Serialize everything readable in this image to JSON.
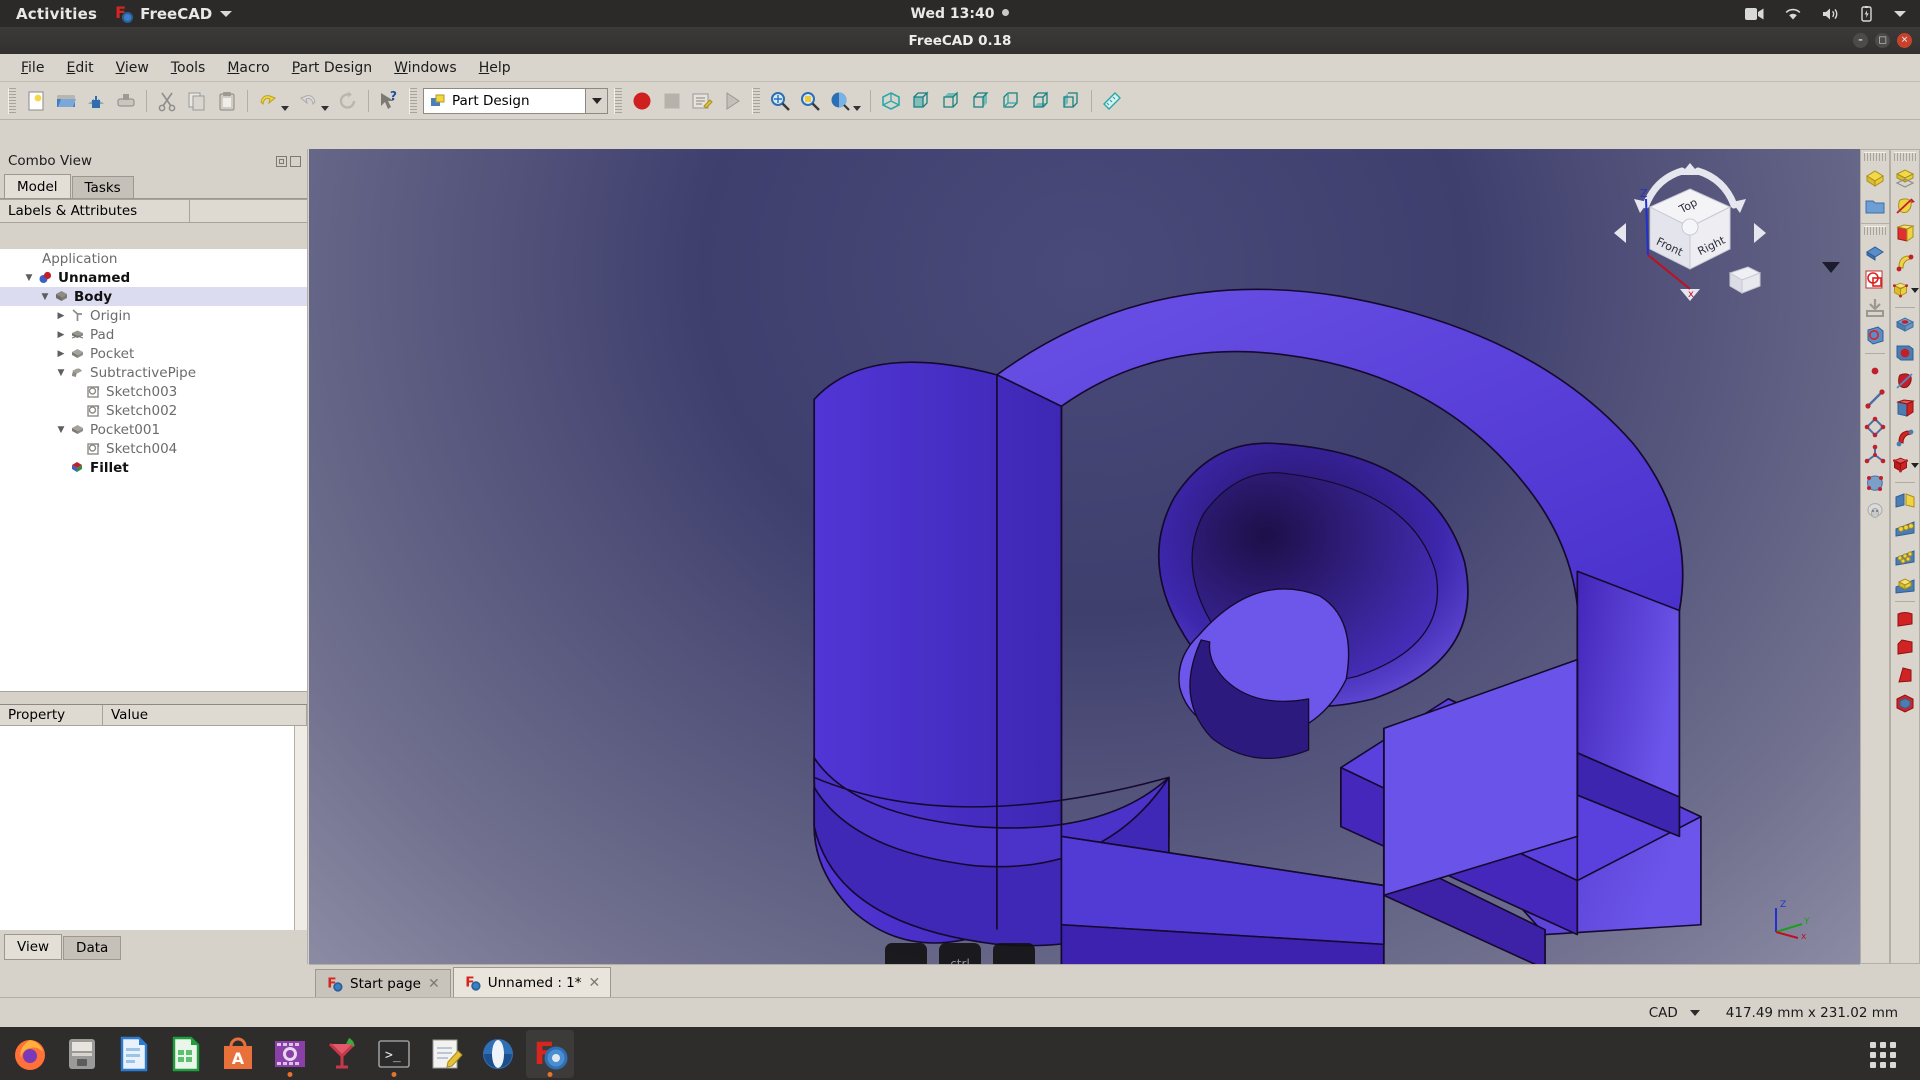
{
  "gnome": {
    "activities": "Activities",
    "app_name": "FreeCAD",
    "clock": "Wed 13:40",
    "tray": [
      "camera-icon",
      "wifi-icon",
      "volume-icon",
      "battery-icon",
      "chevron-down-icon"
    ]
  },
  "window": {
    "title": "FreeCAD 0.18",
    "buttons": [
      "minimize",
      "maximize",
      "close"
    ]
  },
  "menubar": [
    {
      "label": "File",
      "mnemonic": "F"
    },
    {
      "label": "Edit",
      "mnemonic": "E"
    },
    {
      "label": "View",
      "mnemonic": "V"
    },
    {
      "label": "Tools",
      "mnemonic": "T"
    },
    {
      "label": "Macro",
      "mnemonic": "M"
    },
    {
      "label": "Part Design",
      "mnemonic": "P"
    },
    {
      "label": "Windows",
      "mnemonic": "W"
    },
    {
      "label": "Help",
      "mnemonic": "H"
    }
  ],
  "toolbar": {
    "workbench_selected": "Part Design",
    "items": [
      "new-document-icon",
      "open-document-icon",
      "save-document-icon",
      "save-as-icon",
      "cut-icon",
      "copy-icon",
      "paste-icon",
      "undo-icon",
      "undo-dropdown-icon",
      "redo-icon",
      "redo-dropdown-icon",
      "refresh-icon",
      "whats-this-icon",
      "macro-record-icon",
      "macro-stop-icon",
      "macro-edit-icon",
      "macro-execute-icon",
      "fit-all-icon",
      "fit-selection-icon",
      "draw-style-icon",
      "draw-style-dropdown-icon",
      "axonometric-icon",
      "front-view-icon",
      "top-view-icon",
      "right-view-icon",
      "rear-view-icon",
      "bottom-view-icon",
      "left-view-icon",
      "measure-icon"
    ]
  },
  "combo_view": {
    "title": "Combo View",
    "tabs": [
      {
        "label": "Model",
        "active": true
      },
      {
        "label": "Tasks",
        "active": false
      }
    ],
    "tree_header": "Labels & Attributes",
    "tree": [
      {
        "label": "Application",
        "depth": 0,
        "expander": "",
        "icon": "",
        "bold": false,
        "selected": false
      },
      {
        "label": "Unnamed",
        "depth": 1,
        "expander": "down",
        "icon": "document-icon",
        "bold": true,
        "selected": false
      },
      {
        "label": "Body",
        "depth": 2,
        "expander": "down",
        "icon": "body-icon",
        "bold": true,
        "selected": true
      },
      {
        "label": "Origin",
        "depth": 3,
        "expander": "right",
        "icon": "origin-icon",
        "bold": false,
        "selected": false
      },
      {
        "label": "Pad",
        "depth": 3,
        "expander": "right",
        "icon": "pad-icon",
        "bold": false,
        "selected": false
      },
      {
        "label": "Pocket",
        "depth": 3,
        "expander": "right",
        "icon": "pocket-icon",
        "bold": false,
        "selected": false
      },
      {
        "label": "SubtractivePipe",
        "depth": 3,
        "expander": "down",
        "icon": "subtractive-pipe-icon",
        "bold": false,
        "selected": false
      },
      {
        "label": "Sketch003",
        "depth": 4,
        "expander": "",
        "icon": "sketch-icon",
        "bold": false,
        "selected": false
      },
      {
        "label": "Sketch002",
        "depth": 4,
        "expander": "",
        "icon": "sketch-icon",
        "bold": false,
        "selected": false
      },
      {
        "label": "Pocket001",
        "depth": 3,
        "expander": "down",
        "icon": "pocket-icon",
        "bold": false,
        "selected": false
      },
      {
        "label": "Sketch004",
        "depth": 4,
        "expander": "",
        "icon": "sketch-icon",
        "bold": false,
        "selected": false
      },
      {
        "label": "Fillet",
        "depth": 3,
        "expander": "",
        "icon": "fillet-icon",
        "bold": true,
        "selected": false
      }
    ],
    "property_columns": [
      "Property",
      "Value"
    ],
    "property_rows": [],
    "bottom_tabs": [
      {
        "label": "View",
        "active": true
      },
      {
        "label": "Data",
        "active": false
      }
    ]
  },
  "view3d": {
    "document_tabs": [
      {
        "label": "Start page",
        "active": false,
        "icon": "freecad-icon",
        "close": "✕"
      },
      {
        "label": "Unnamed : 1*",
        "active": true,
        "icon": "freecad-icon",
        "close": "✕"
      }
    ],
    "navcube": {
      "top": "Top",
      "front": "Front",
      "right": "Right"
    },
    "axis_labels": {
      "x": "x",
      "y": "Y",
      "z": "Z"
    },
    "model_color": "#4b32c8",
    "background_top": "#41416f",
    "background_bottom": "#8b8ba4",
    "keystroke_overlay": [
      "",
      "ctrl",
      ""
    ]
  },
  "right_toolbars": {
    "part_design_helper": [
      "create-body-icon",
      "create-group-icon"
    ],
    "part_design_modeling": [
      "create-sketch-icon",
      "edit-sketch-icon",
      "map-sketch-icon",
      "create-datum-point-icon",
      "create-datum-line-icon",
      "create-datum-plane-icon",
      "create-local-cs-icon",
      "create-shape-binder-icon",
      "create-sub-object-binder-icon"
    ],
    "part_design_features": [
      "pad-icon",
      "revolution-icon",
      "additive-loft-icon",
      "additive-pipe-icon",
      "additive-box-primitive-icon",
      "pocket-icon",
      "hole-icon",
      "groove-icon",
      "subtractive-loft-icon",
      "subtractive-pipe-icon",
      "subtractive-box-primitive-icon",
      "mirrored-icon",
      "linear-pattern-icon",
      "polar-pattern-icon",
      "multi-transform-icon",
      "fillet-icon",
      "chamfer-icon",
      "draft-icon",
      "thickness-icon"
    ]
  },
  "statusbar": {
    "mode": "CAD",
    "dimensions": "417.49 mm x 231.02 mm"
  },
  "dock": {
    "apps": [
      {
        "name": "firefox-icon",
        "running": false,
        "active": false
      },
      {
        "name": "files-icon",
        "running": false,
        "active": false
      },
      {
        "name": "libreoffice-writer-icon",
        "running": false,
        "active": false
      },
      {
        "name": "libreoffice-calc-icon",
        "running": false,
        "active": false
      },
      {
        "name": "ubuntu-software-icon",
        "running": false,
        "active": false
      },
      {
        "name": "app-grid-purple-icon",
        "running": true,
        "active": false
      },
      {
        "name": "gimp-icon",
        "running": false,
        "active": false
      },
      {
        "name": "terminal-icon",
        "running": true,
        "active": false
      },
      {
        "name": "text-editor-icon",
        "running": false,
        "active": false
      },
      {
        "name": "vlc-icon",
        "running": false,
        "active": false
      },
      {
        "name": "freecad-icon",
        "running": true,
        "active": true
      }
    ],
    "show_apps": "show-applications-icon"
  }
}
